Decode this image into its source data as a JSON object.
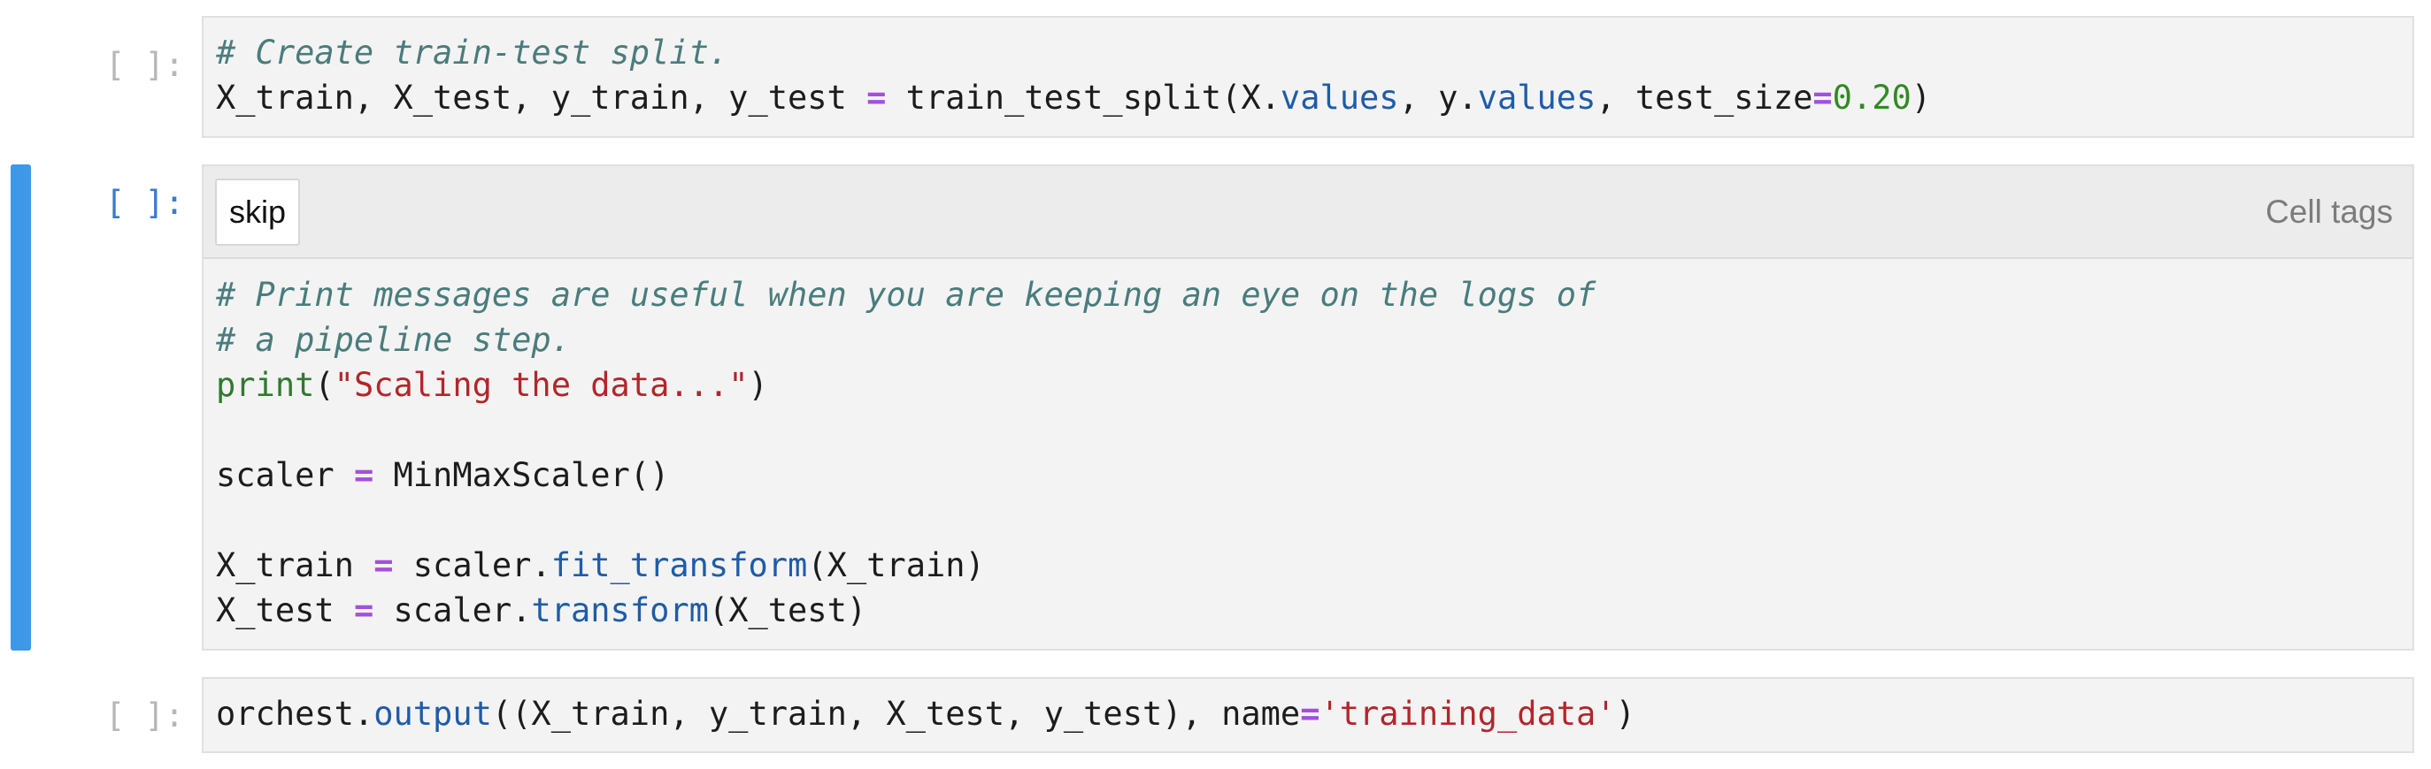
{
  "cells": [
    {
      "prompt": "[ ]:",
      "lines": [
        [
          {
            "t": "# Create train-test split.",
            "c": "cm"
          }
        ],
        [
          {
            "t": "X_train, X_test, y_train, y_test ",
            "c": ""
          },
          {
            "t": "=",
            "c": "op"
          },
          {
            "t": " train_test_split(X.",
            "c": ""
          },
          {
            "t": "values",
            "c": "attr"
          },
          {
            "t": ", y.",
            "c": ""
          },
          {
            "t": "values",
            "c": "attr"
          },
          {
            "t": ", test_size",
            "c": ""
          },
          {
            "t": "=",
            "c": "op"
          },
          {
            "t": "0.20",
            "c": "num"
          },
          {
            "t": ")",
            "c": ""
          }
        ]
      ]
    },
    {
      "prompt": "[ ]:",
      "tag": "skip",
      "tags_label": "Cell tags",
      "lines": [
        [
          {
            "t": "# Print messages are useful when you are keeping an eye on the logs of",
            "c": "cm"
          }
        ],
        [
          {
            "t": "# a pipeline step.",
            "c": "cm"
          }
        ],
        [
          {
            "t": "print",
            "c": "bi"
          },
          {
            "t": "(",
            "c": ""
          },
          {
            "t": "\"Scaling the data...\"",
            "c": "str"
          },
          {
            "t": ")",
            "c": ""
          }
        ],
        [],
        [
          {
            "t": "scaler ",
            "c": ""
          },
          {
            "t": "=",
            "c": "op"
          },
          {
            "t": " MinMaxScaler()",
            "c": ""
          }
        ],
        [],
        [
          {
            "t": "X_train ",
            "c": ""
          },
          {
            "t": "=",
            "c": "op"
          },
          {
            "t": " scaler.",
            "c": ""
          },
          {
            "t": "fit_transform",
            "c": "attr"
          },
          {
            "t": "(X_train)",
            "c": ""
          }
        ],
        [
          {
            "t": "X_test ",
            "c": ""
          },
          {
            "t": "=",
            "c": "op"
          },
          {
            "t": " scaler.",
            "c": ""
          },
          {
            "t": "transform",
            "c": "attr"
          },
          {
            "t": "(X_test)",
            "c": ""
          }
        ]
      ]
    },
    {
      "prompt": "[ ]:",
      "lines": [
        [
          {
            "t": "orchest.",
            "c": ""
          },
          {
            "t": "output",
            "c": "attr"
          },
          {
            "t": "((X_train, y_train, X_test, y_test), name",
            "c": ""
          },
          {
            "t": "=",
            "c": "op"
          },
          {
            "t": "'training_data'",
            "c": "str"
          },
          {
            "t": ")",
            "c": ""
          }
        ]
      ]
    }
  ],
  "colors": {
    "active_bar": "#3d98e8",
    "comment": "#4a7c7c",
    "operator": "#a64fdb",
    "attribute": "#1f5ca8",
    "number": "#318a23",
    "builtin": "#2f7a2f",
    "string": "#b2262b"
  }
}
